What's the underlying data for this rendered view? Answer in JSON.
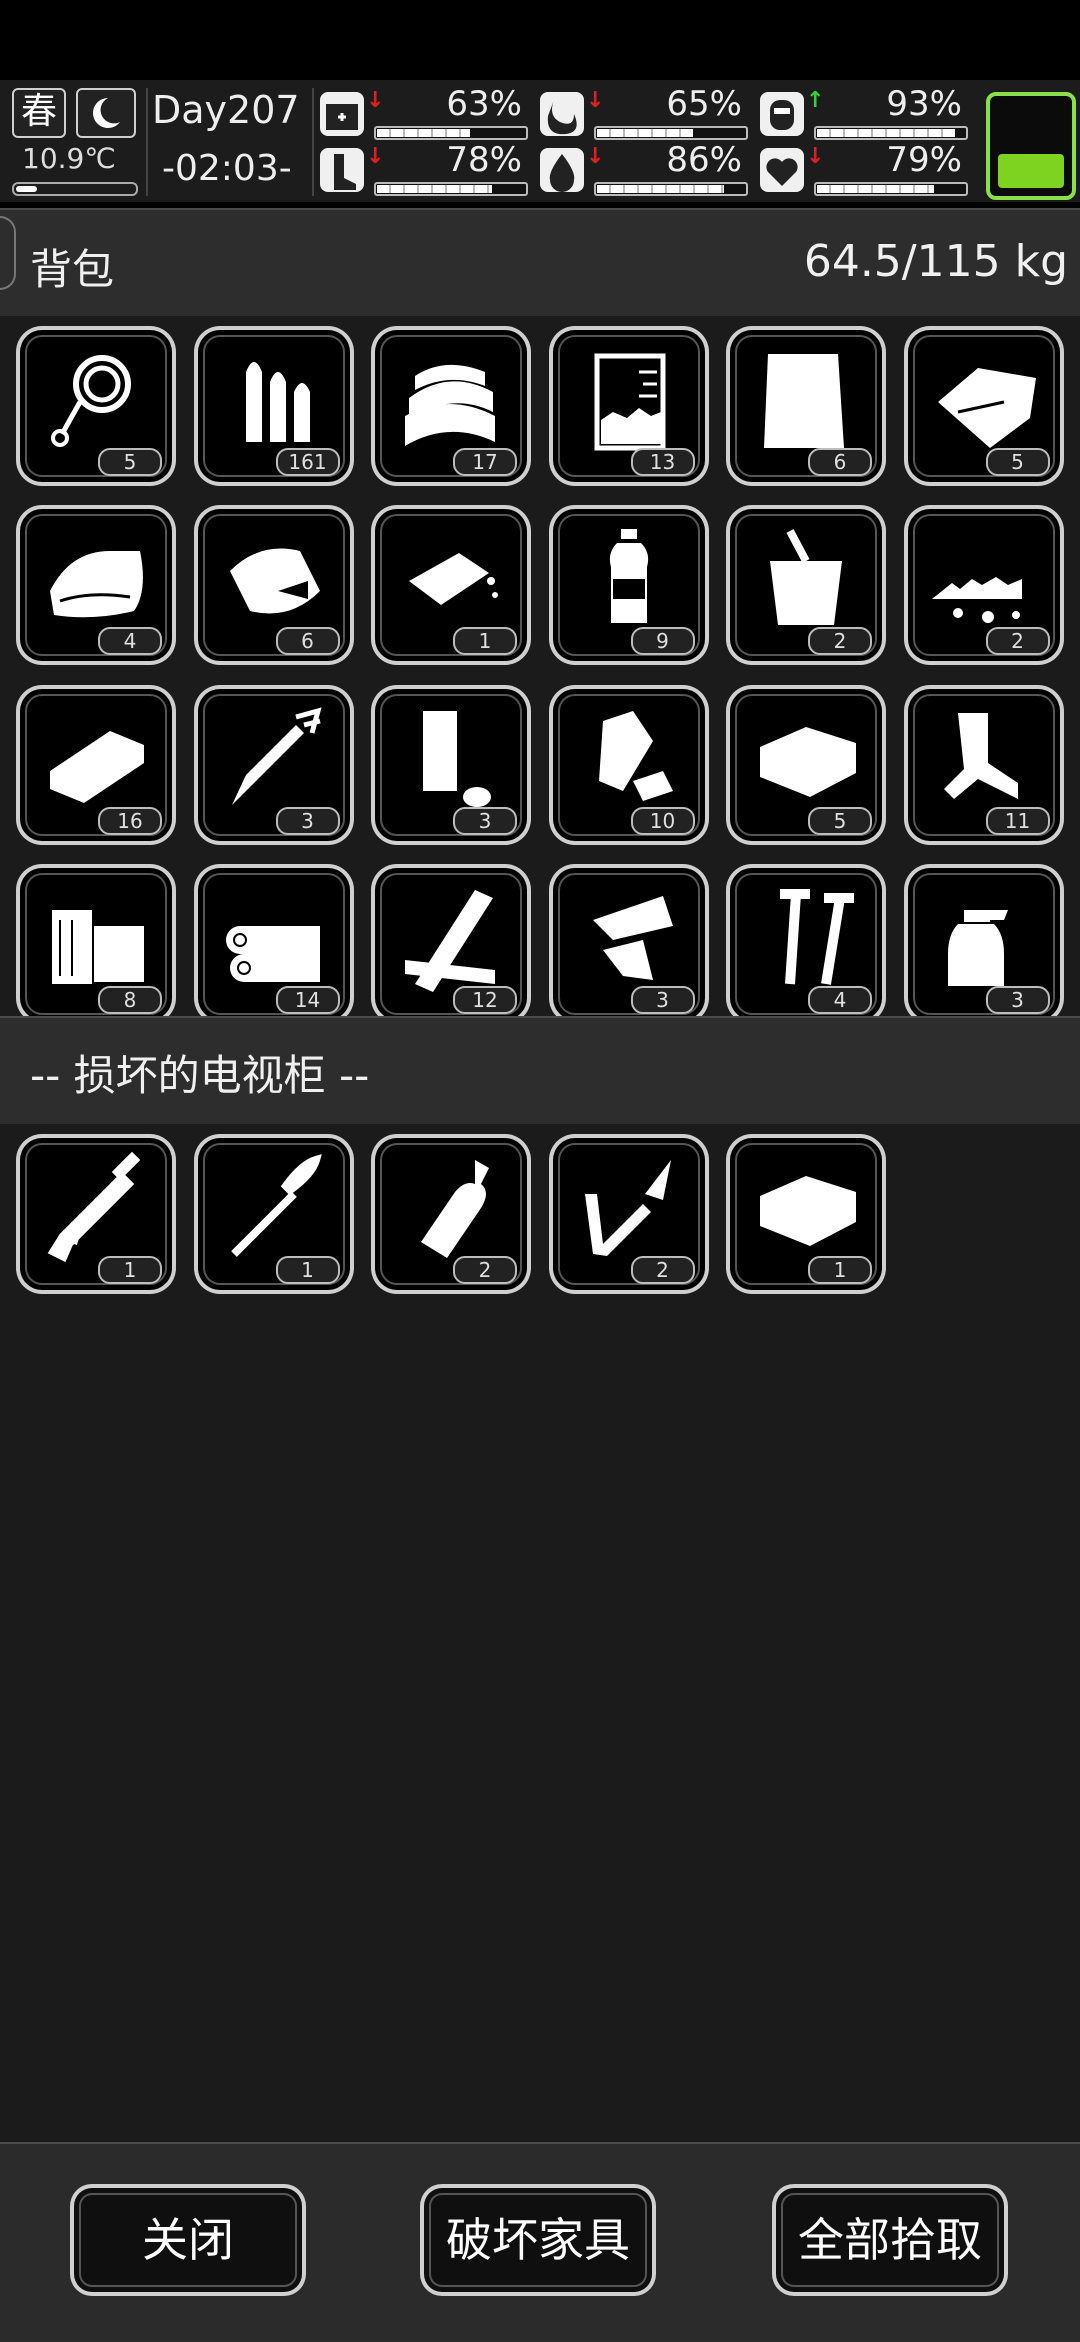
{
  "hud": {
    "season": "春",
    "temperature": "10.9℃",
    "temperature_level": 0.18,
    "day": "Day207",
    "time": "-02:03-",
    "stats": [
      {
        "name": "health",
        "icon": "medkit-icon",
        "trend": "down",
        "value": "63%",
        "level": 0.63
      },
      {
        "name": "hunger",
        "icon": "stomach-icon",
        "trend": "down",
        "value": "65%",
        "level": 0.65
      },
      {
        "name": "mood",
        "icon": "head-icon",
        "trend": "up",
        "value": "93%",
        "level": 0.93
      },
      {
        "name": "stamina",
        "icon": "foot-icon",
        "trend": "down",
        "value": "78%",
        "level": 0.78
      },
      {
        "name": "thirst",
        "icon": "water-drop-icon",
        "trend": "down",
        "value": "86%",
        "level": 0.86
      },
      {
        "name": "sanity",
        "icon": "heart-icon",
        "trend": "down",
        "value": "79%",
        "level": 0.79
      }
    ],
    "battery_level": 0.4,
    "colors": {
      "trend_down": "#e02020",
      "trend_up": "#35d035",
      "battery": "#7ed321"
    }
  },
  "backpack": {
    "title": "背包",
    "weight": "64.5/115 kg",
    "items": [
      {
        "icon": "rope-icon",
        "count": "5"
      },
      {
        "icon": "bullets-icon",
        "count": "161"
      },
      {
        "icon": "folded-cloth-icon",
        "count": "17"
      },
      {
        "icon": "beaker-icon",
        "count": "13"
      },
      {
        "icon": "paper-sheet-icon",
        "count": "6"
      },
      {
        "icon": "torn-paper-icon",
        "count": "5"
      },
      {
        "icon": "cloth-roll-icon",
        "count": "4"
      },
      {
        "icon": "bread-icon",
        "count": "6"
      },
      {
        "icon": "soap-icon",
        "count": "1"
      },
      {
        "icon": "water-bottle-icon",
        "count": "9"
      },
      {
        "icon": "bucket-icon",
        "count": "2"
      },
      {
        "icon": "rubble-icon",
        "count": "2"
      },
      {
        "icon": "brick-icon",
        "count": "16"
      },
      {
        "icon": "arrow-icon",
        "count": "3"
      },
      {
        "icon": "can-icon",
        "count": "3"
      },
      {
        "icon": "plastic-trash-icon",
        "count": "10"
      },
      {
        "icon": "box-icon",
        "count": "5"
      },
      {
        "icon": "scrap-icon",
        "count": "11"
      },
      {
        "icon": "wood-block-icon",
        "count": "8"
      },
      {
        "icon": "logs-icon",
        "count": "14"
      },
      {
        "icon": "planks-icon",
        "count": "12"
      },
      {
        "icon": "glass-shards-icon",
        "count": "3"
      },
      {
        "icon": "screws-icon",
        "count": "4"
      },
      {
        "icon": "spray-bottle-icon",
        "count": "3"
      }
    ]
  },
  "container": {
    "title": "-- 损坏的电视柜 --",
    "items": [
      {
        "icon": "rifle-icon",
        "count": "1"
      },
      {
        "icon": "rocket-icon",
        "count": "1"
      },
      {
        "icon": "bottle-icon",
        "count": "2"
      },
      {
        "icon": "spear-icon",
        "count": "2"
      },
      {
        "icon": "box-icon",
        "count": "1"
      }
    ]
  },
  "buttons": {
    "close": "关闭",
    "destroy": "破坏家具",
    "take_all": "全部拾取"
  }
}
